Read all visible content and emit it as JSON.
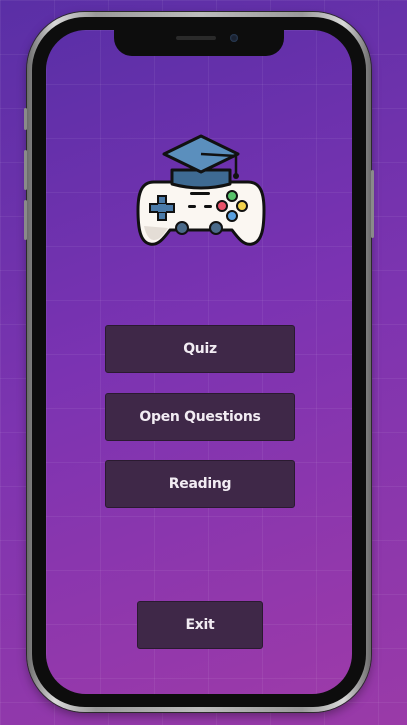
{
  "menu": {
    "quiz_label": "Quiz",
    "open_questions_label": "Open Questions",
    "reading_label": "Reading",
    "exit_label": "Exit"
  },
  "logo": {
    "icon": "gamepad-with-graduation-cap-icon"
  },
  "colors": {
    "background_top": "#5a2fa6",
    "background_bottom": "#9a3aa8",
    "button_fill": "#3f2848",
    "button_text": "#f2ecf3"
  }
}
